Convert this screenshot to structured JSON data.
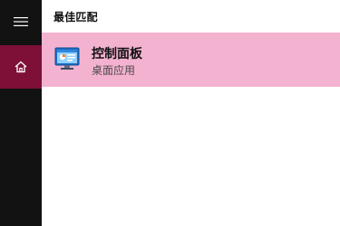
{
  "rail": {
    "menu_icon": "hamburger-menu-icon",
    "home_icon": "home-icon",
    "accent_color": "#7e1038"
  },
  "section": {
    "title": "最佳匹配"
  },
  "best_match": {
    "title": "控制面板",
    "subtitle": "桌面应用",
    "icon": "control-panel-icon",
    "highlight_color": "#f4b2d1"
  }
}
